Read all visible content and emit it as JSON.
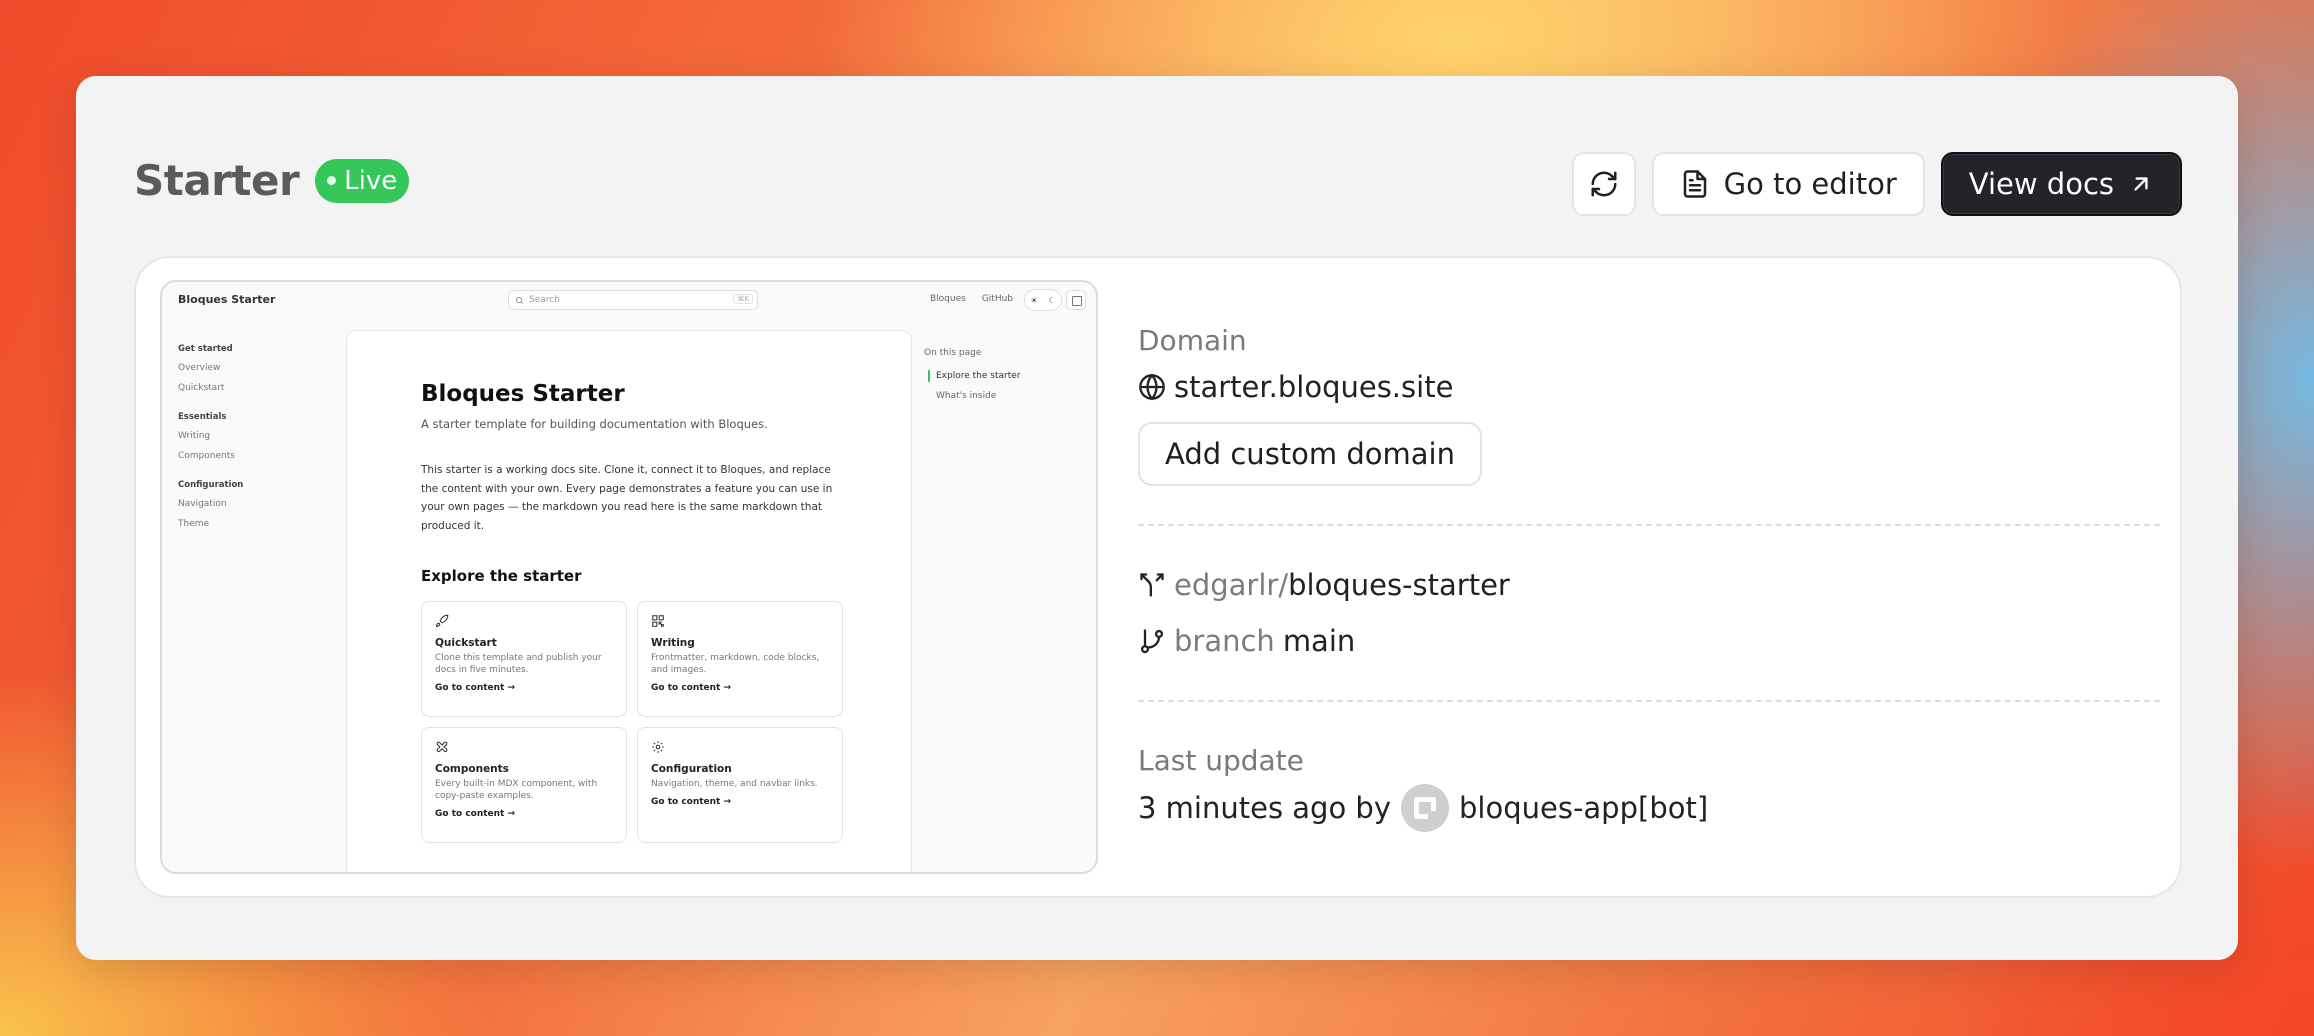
{
  "header": {
    "title": "Starter",
    "status": "Live",
    "refresh_icon": "refresh-icon",
    "editor_label": "Go to editor",
    "editor_icon": "document-icon",
    "docs_label": "View docs",
    "docs_icon": "arrow-up-right-icon"
  },
  "preview": {
    "brand": "Bloques Starter",
    "search_placeholder": "Search",
    "search_shortcut": "⌘K",
    "nav_links": [
      "Bloques",
      "GitHub"
    ],
    "sidebar": [
      {
        "group": "Get started",
        "items": [
          "Overview",
          "Quickstart"
        ]
      },
      {
        "group": "Essentials",
        "items": [
          "Writing",
          "Components"
        ]
      },
      {
        "group": "Configuration",
        "items": [
          "Navigation",
          "Theme"
        ]
      }
    ],
    "heading": "Bloques Starter",
    "subtitle": "A starter template for building documentation with Bloques.",
    "intro": "This starter is a working docs site. Clone it, connect it to Bloques, and replace the content with your own. Every page demonstrates a feature you can use in your own pages — the markdown you read here is the same markdown that produced it.",
    "section_heading": "Explore the starter",
    "cards": [
      {
        "icon": "rocket-icon",
        "title": "Quickstart",
        "desc": "Clone this template and publish your docs in five minutes.",
        "link": "Go to content →"
      },
      {
        "icon": "qr-code-icon",
        "title": "Writing",
        "desc": "Frontmatter, markdown, code blocks, and images.",
        "link": "Go to content →"
      },
      {
        "icon": "puzzle-icon",
        "title": "Components",
        "desc": "Every built-in MDX component, with copy-paste examples.",
        "link": "Go to content →"
      },
      {
        "icon": "gear-icon",
        "title": "Configuration",
        "desc": "Navigation, theme, and navbar links.",
        "link": "Go to content →"
      }
    ],
    "toc": {
      "label": "On this page",
      "items": [
        "Explore the starter",
        "What's inside"
      ]
    }
  },
  "info": {
    "domain_label": "Domain",
    "domain_icon": "globe-icon",
    "domain": "starter.bloques.site",
    "add_domain_label": "Add custom domain",
    "repo_icon": "git-fork-icon",
    "repo_owner": "edgarlr/",
    "repo_name": "bloques-starter",
    "branch_icon": "git-branch-icon",
    "branch_label": "branch",
    "branch_name": "main",
    "last_update_label": "Last update",
    "last_update_time": "3 minutes ago by",
    "last_update_author": "bloques-app[bot]"
  },
  "colors": {
    "live_green": "#35c759",
    "dark_button": "#23232a"
  }
}
